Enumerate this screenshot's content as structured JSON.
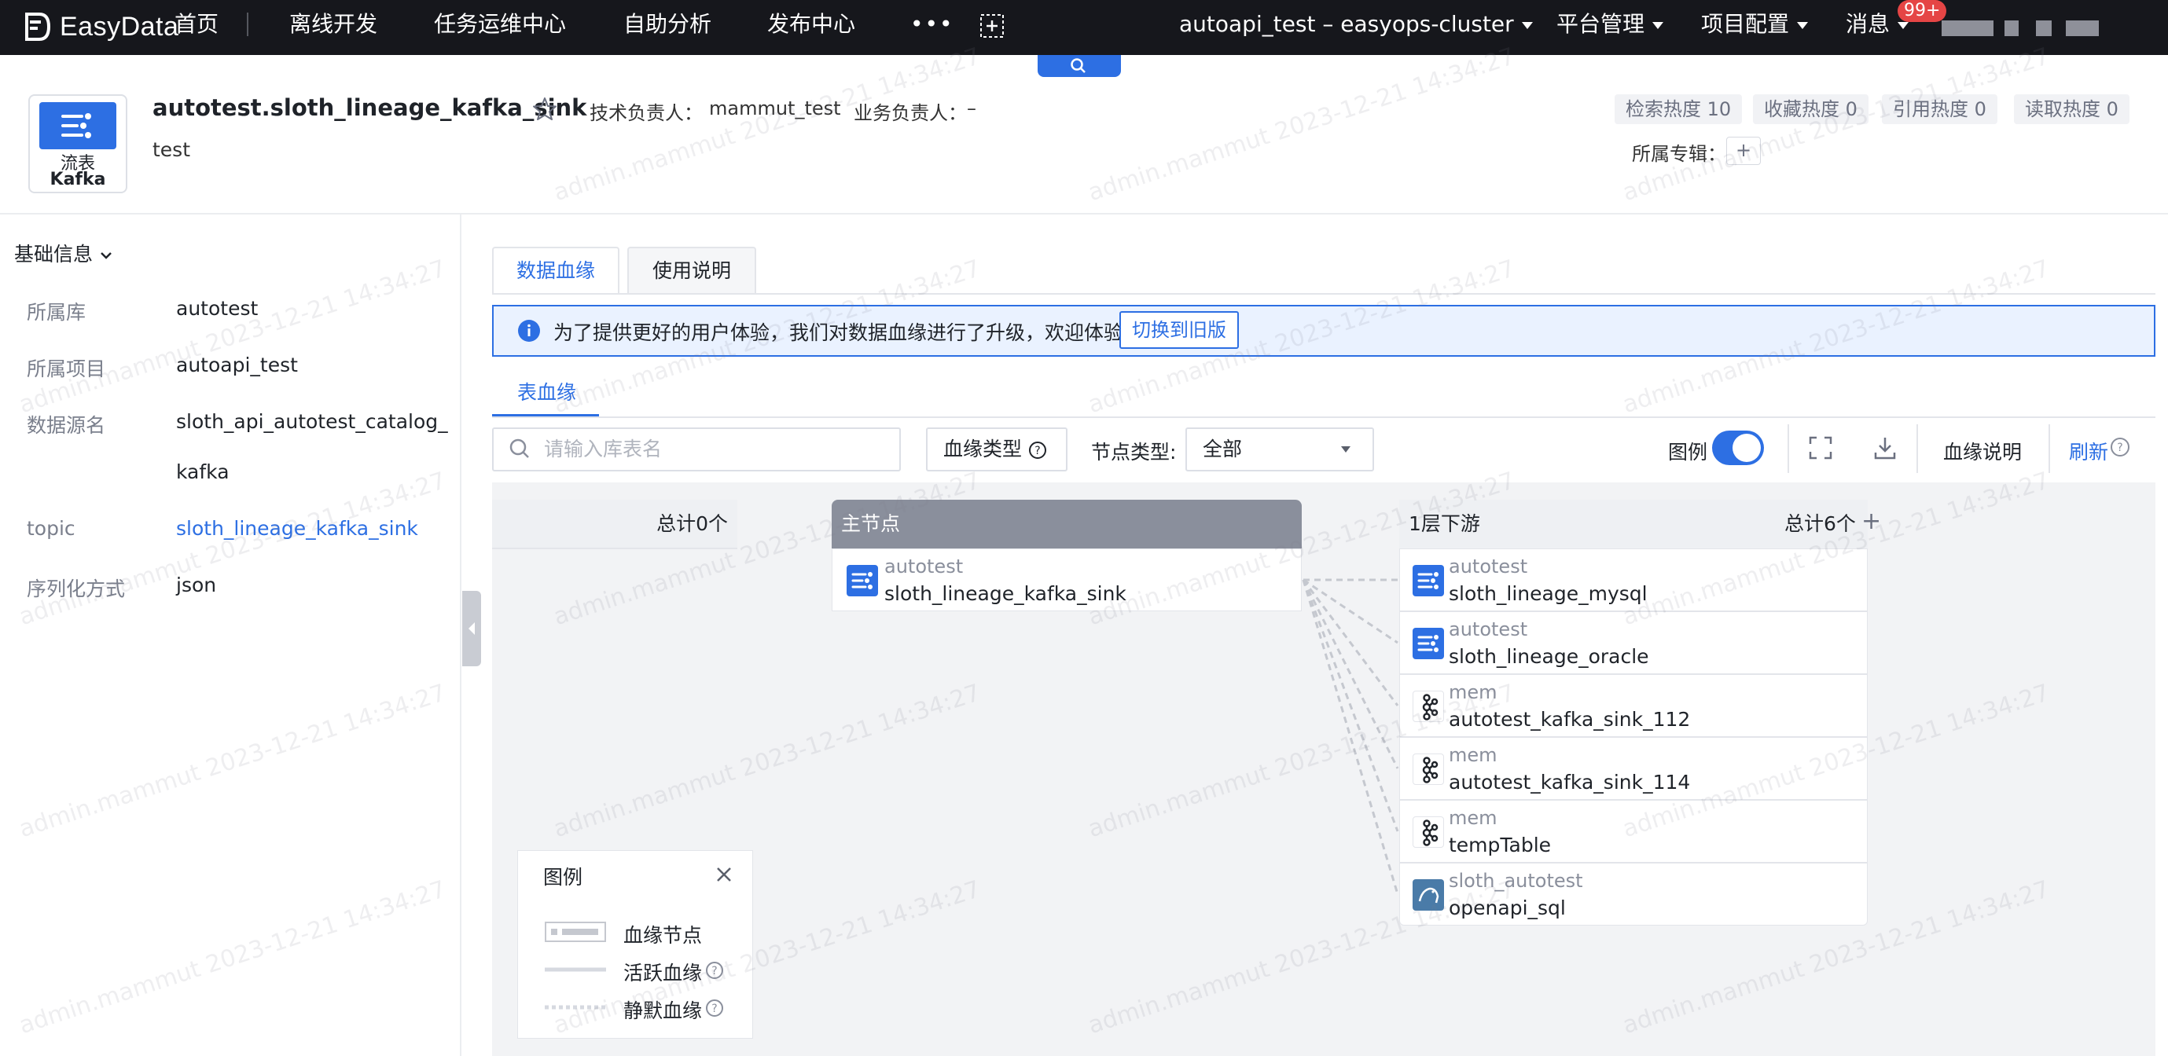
{
  "nav": {
    "logo_text": "EasyData",
    "items": [
      "首页",
      "离线开发",
      "任务运维中心",
      "自助分析",
      "发布中心"
    ],
    "more": "•••",
    "cluster": "autoapi_test – easyops-cluster",
    "platform_admin": "平台管理",
    "project_config": "项目配置",
    "messages": "消息",
    "badge": "99+"
  },
  "header": {
    "type_label": "流表",
    "type_sub": "Kafka",
    "title": "autotest.sloth_lineage_kafka_sink",
    "description": "test",
    "tech_owner_label": "技术负责人：",
    "tech_owner": "mammut_test",
    "biz_owner_label": "业务负责人：",
    "biz_owner": "–",
    "stats": [
      "检索热度 10",
      "收藏热度 0",
      "引用热度 0",
      "读取热度 0"
    ],
    "collection_label": "所属专辑：",
    "collection_add": "+"
  },
  "sidebar": {
    "section_title": "基础信息",
    "fields": [
      {
        "label": "所属库",
        "value": "autotest"
      },
      {
        "label": "所属项目",
        "value": "autoapi_test"
      },
      {
        "label": "数据源名",
        "value": "sloth_api_autotest_catalog_",
        "value2": "kafka"
      },
      {
        "label": "topic",
        "value": "sloth_lineage_kafka_sink"
      },
      {
        "label": "序列化方式",
        "value": "json"
      }
    ]
  },
  "main": {
    "tabs": [
      "数据血缘",
      "使用说明"
    ],
    "banner_text": "为了提供更好的用户体验，我们对数据血缘进行了升级，欢迎体验。",
    "banner_button": "切换到旧版",
    "subtab": "表血缘",
    "search_placeholder": "请输入库表名",
    "lineage_type": "血缘类型",
    "node_type_label": "节点类型:",
    "node_type_value": "全部",
    "legend_toggle": "图例",
    "lineage_help": "血缘说明",
    "refresh": "刷新"
  },
  "graph": {
    "upstream_total": "总计0个",
    "main_label": "主节点",
    "main_node": {
      "db": "autotest",
      "table": "sloth_lineage_kafka_sink"
    },
    "downstream_label": "1层下游",
    "downstream_total": "总计6个",
    "downstream_add": "+",
    "downstream": [
      {
        "db": "autotest",
        "table": "sloth_lineage_mysql",
        "icon": "stream-icon"
      },
      {
        "db": "autotest",
        "table": "sloth_lineage_oracle",
        "icon": "stream-icon"
      },
      {
        "db": "mem",
        "table": "autotest_kafka_sink_112",
        "icon": "kafka-icon"
      },
      {
        "db": "mem",
        "table": "autotest_kafka_sink_114",
        "icon": "kafka-icon"
      },
      {
        "db": "mem",
        "table": "tempTable",
        "icon": "kafka-icon"
      },
      {
        "db": "sloth_autotest",
        "table": "openapi_sql",
        "icon": "mysql-icon"
      }
    ]
  },
  "legend": {
    "title": "图例",
    "items": [
      "血缘节点",
      "活跃血缘",
      "静默血缘"
    ]
  },
  "watermark": "admin.mammut 2023-12-21 14:34:27",
  "colors": {
    "nav_bg": "#16171c",
    "accent": "#2d6fe3",
    "main_header": "#8a8f9c"
  }
}
